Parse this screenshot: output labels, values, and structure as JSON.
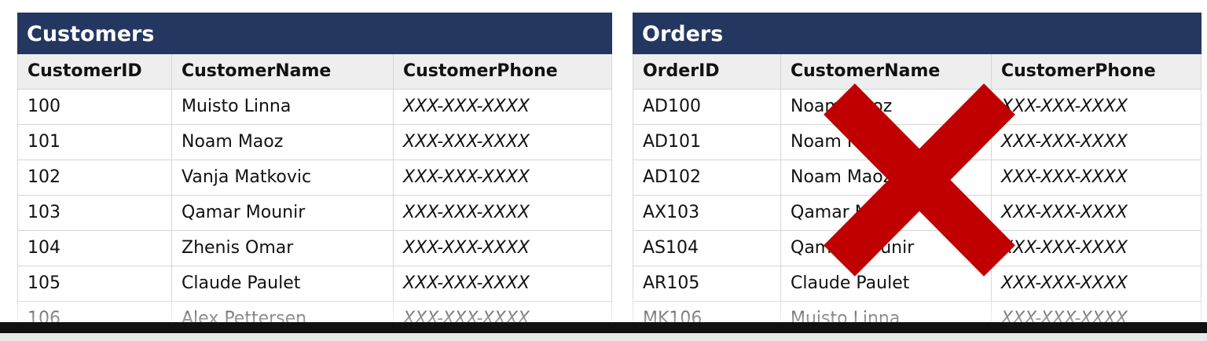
{
  "customers": {
    "title": "Customers",
    "columns": [
      "CustomerID",
      "CustomerName",
      "CustomerPhone"
    ],
    "rows": [
      [
        "100",
        "Muisto Linna",
        "XXX-XXX-XXXX"
      ],
      [
        "101",
        "Noam Maoz",
        "XXX-XXX-XXXX"
      ],
      [
        "102",
        "Vanja Matkovic",
        "XXX-XXX-XXXX"
      ],
      [
        "103",
        "Qamar Mounir",
        "XXX-XXX-XXXX"
      ],
      [
        "104",
        "Zhenis Omar",
        "XXX-XXX-XXXX"
      ],
      [
        "105",
        "Claude Paulet",
        "XXX-XXX-XXXX"
      ],
      [
        "106",
        "Alex Pettersen",
        "XXX-XXX-XXXX"
      ]
    ]
  },
  "orders": {
    "title": "Orders",
    "columns": [
      "OrderID",
      "CustomerName",
      "CustomerPhone"
    ],
    "rows": [
      [
        "AD100",
        "Noam Maoz",
        "XXX-XXX-XXXX"
      ],
      [
        "AD101",
        "Noam Maoz",
        "XXX-XXX-XXXX"
      ],
      [
        "AD102",
        "Noam Maoz",
        "XXX-XXX-XXXX"
      ],
      [
        "AX103",
        "Qamar Mounir",
        "XXX-XXX-XXXX"
      ],
      [
        "AS104",
        "Qamar Mounir",
        "XXX-XXX-XXXX"
      ],
      [
        "AR105",
        "Claude Paulet",
        "XXX-XXX-XXXX"
      ],
      [
        "MK106",
        "Muisto Linna",
        "XXX-XXX-XXXX"
      ]
    ]
  },
  "overlay": {
    "icon": "cross-icon",
    "color": "#c00000"
  },
  "colors": {
    "header_bg": "#233760",
    "header_text": "#ffffff",
    "column_header_bg": "#eeeeee"
  }
}
